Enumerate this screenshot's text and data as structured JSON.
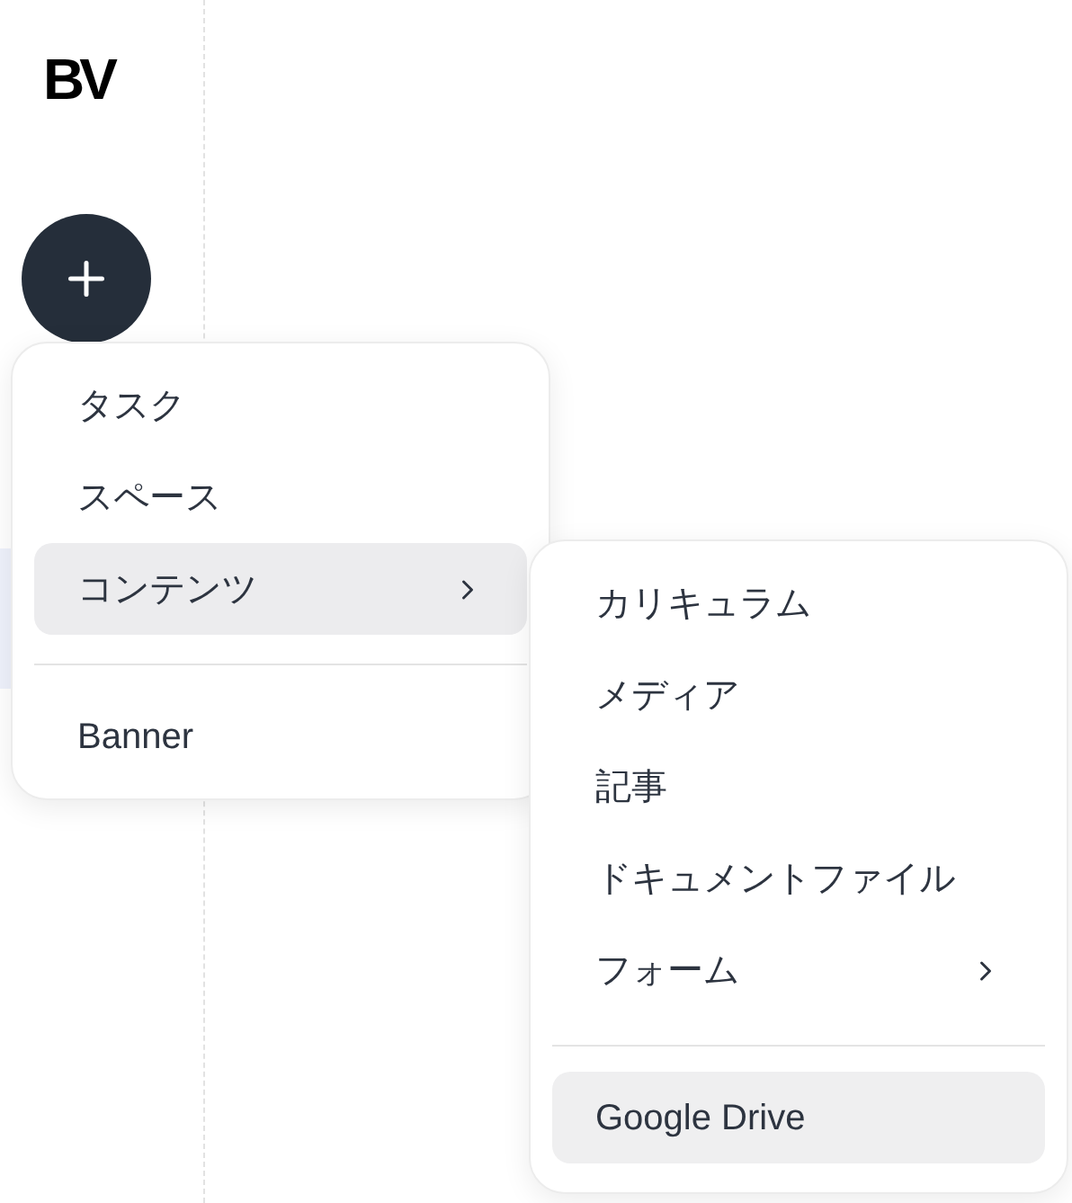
{
  "logo": "BV",
  "menu": {
    "groups": [
      [
        {
          "label": "タスク",
          "selected": false,
          "has_submenu": false
        },
        {
          "label": "スペース",
          "selected": false,
          "has_submenu": false
        },
        {
          "label": "コンテンツ",
          "selected": true,
          "has_submenu": true
        }
      ],
      [
        {
          "label": "Banner",
          "selected": false,
          "has_submenu": false
        }
      ]
    ]
  },
  "submenu": {
    "groups": [
      [
        {
          "label": "カリキュラム",
          "selected": false,
          "has_submenu": false
        },
        {
          "label": "メディア",
          "selected": false,
          "has_submenu": false
        },
        {
          "label": "記事",
          "selected": false,
          "has_submenu": false
        },
        {
          "label": "ドキュメントファイル",
          "selected": false,
          "has_submenu": false
        },
        {
          "label": "フォーム",
          "selected": false,
          "has_submenu": true
        }
      ],
      [
        {
          "label": "Google Drive",
          "selected": true,
          "has_submenu": false
        }
      ]
    ]
  }
}
